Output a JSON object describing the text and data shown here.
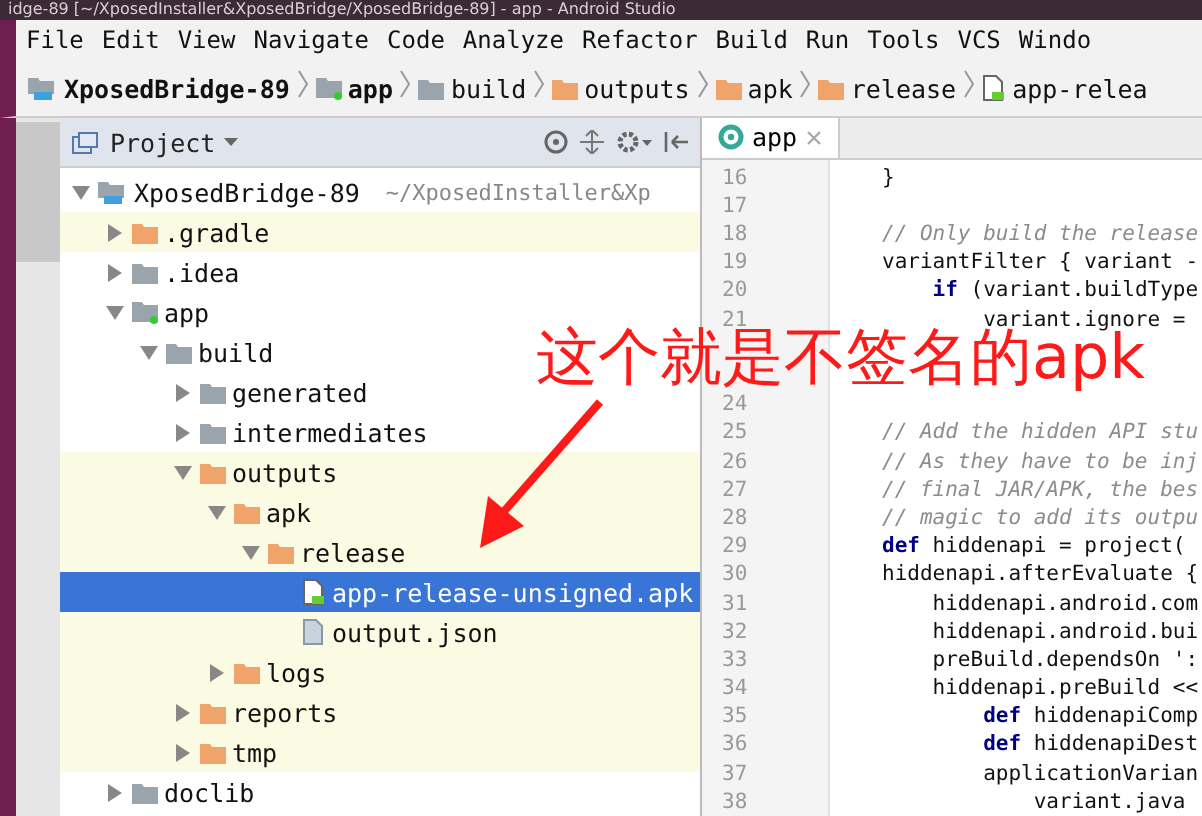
{
  "window": {
    "title": "idge-89 [~/XposedInstaller&XposedBridge/XposedBridge-89] - app - Android Studio"
  },
  "menu": [
    "File",
    "Edit",
    "View",
    "Navigate",
    "Code",
    "Analyze",
    "Refactor",
    "Build",
    "Run",
    "Tools",
    "VCS",
    "Windo"
  ],
  "breadcrumbs": [
    {
      "label": "XposedBridge-89",
      "kind": "project",
      "bold": true
    },
    {
      "label": "app",
      "kind": "module",
      "bold": true
    },
    {
      "label": "build",
      "kind": "folder",
      "bold": false
    },
    {
      "label": "outputs",
      "kind": "output",
      "bold": false
    },
    {
      "label": "apk",
      "kind": "output",
      "bold": false
    },
    {
      "label": "release",
      "kind": "output",
      "bold": false
    },
    {
      "label": "app-relea",
      "kind": "apk",
      "bold": false
    }
  ],
  "project_panel": {
    "title": "Project",
    "tree": [
      {
        "label": "XposedBridge-89",
        "path": "~/XposedInstaller&Xp",
        "kind": "project",
        "expanded": true,
        "highlighted": false,
        "selected": false,
        "children": [
          {
            "label": ".gradle",
            "kind": "output",
            "expanded": false,
            "highlighted": true,
            "selected": false
          },
          {
            "label": ".idea",
            "kind": "folder",
            "expanded": false,
            "highlighted": false,
            "selected": false
          },
          {
            "label": "app",
            "kind": "module",
            "expanded": true,
            "highlighted": false,
            "selected": false,
            "children": [
              {
                "label": "build",
                "kind": "folder",
                "expanded": true,
                "highlighted": false,
                "selected": false,
                "children": [
                  {
                    "label": "generated",
                    "kind": "folder",
                    "expanded": false,
                    "highlighted": false,
                    "selected": false
                  },
                  {
                    "label": "intermediates",
                    "kind": "folder",
                    "expanded": false,
                    "highlighted": false,
                    "selected": false
                  },
                  {
                    "label": "outputs",
                    "kind": "output",
                    "expanded": true,
                    "highlighted": true,
                    "selected": false,
                    "children": [
                      {
                        "label": "apk",
                        "kind": "output",
                        "expanded": true,
                        "highlighted": true,
                        "selected": false,
                        "children": [
                          {
                            "label": "release",
                            "kind": "output",
                            "expanded": true,
                            "highlighted": true,
                            "selected": false,
                            "children": [
                              {
                                "label": "app-release-unsigned.apk",
                                "kind": "apk",
                                "highlighted": true,
                                "selected": true
                              },
                              {
                                "label": "output.json",
                                "kind": "json",
                                "highlighted": true,
                                "selected": false
                              }
                            ]
                          }
                        ]
                      },
                      {
                        "label": "logs",
                        "kind": "output",
                        "expanded": false,
                        "highlighted": true,
                        "selected": false
                      }
                    ]
                  },
                  {
                    "label": "reports",
                    "kind": "output",
                    "expanded": false,
                    "highlighted": true,
                    "selected": false
                  },
                  {
                    "label": "tmp",
                    "kind": "output",
                    "expanded": false,
                    "highlighted": true,
                    "selected": false
                  }
                ]
              }
            ]
          },
          {
            "label": "doclib",
            "kind": "folder",
            "expanded": false,
            "highlighted": false,
            "selected": false
          }
        ]
      }
    ]
  },
  "editor": {
    "tabs": [
      {
        "label": "app",
        "selected": true
      }
    ],
    "lines": [
      {
        "number": "16",
        "kind": "code",
        "text": "}"
      },
      {
        "number": "17",
        "kind": "blank"
      },
      {
        "number": "18",
        "kind": "comment",
        "text": "// Only build the release"
      },
      {
        "number": "19",
        "kind": "code",
        "text": "variantFilter { variant -"
      },
      {
        "number": "20",
        "kind": "code",
        "text": "    **if** (variant.buildType"
      },
      {
        "number": "21",
        "kind": "code",
        "text": "        variant.ignore ="
      },
      {
        "kind": "covered"
      },
      {
        "kind": "covered"
      },
      {
        "number": "24",
        "kind": "blank"
      },
      {
        "number": "25",
        "kind": "comment",
        "text": "// Add the hidden API stu"
      },
      {
        "number": "26",
        "kind": "comment",
        "text": "// As they have to be inj"
      },
      {
        "number": "27",
        "kind": "comment",
        "text": "// final JAR/APK, the bes"
      },
      {
        "number": "28",
        "kind": "comment",
        "text": "// magic to add its outpu"
      },
      {
        "number": "29",
        "kind": "code",
        "text": "**def** hiddenapi = project("
      },
      {
        "number": "30",
        "kind": "code",
        "text": "hiddenapi.afterEvaluate {"
      },
      {
        "number": "31",
        "kind": "code",
        "text": "    hiddenapi.android.com"
      },
      {
        "number": "32",
        "kind": "code",
        "text": "    hiddenapi.android.bui"
      },
      {
        "number": "33",
        "kind": "code",
        "text": "    preBuild.dependsOn ':"
      },
      {
        "number": "34",
        "kind": "code",
        "text": "    hiddenapi.preBuild <<"
      },
      {
        "number": "35",
        "kind": "code",
        "text": "        **def** hiddenapiComp"
      },
      {
        "number": "36",
        "kind": "code",
        "text": "        **def** hiddenapiDest"
      },
      {
        "number": "37",
        "kind": "code",
        "text": "        applicationVarian"
      },
      {
        "number": "38",
        "kind": "code",
        "text": "            variant.java"
      }
    ]
  },
  "annotation": {
    "text": "这个就是不签名的apk"
  }
}
